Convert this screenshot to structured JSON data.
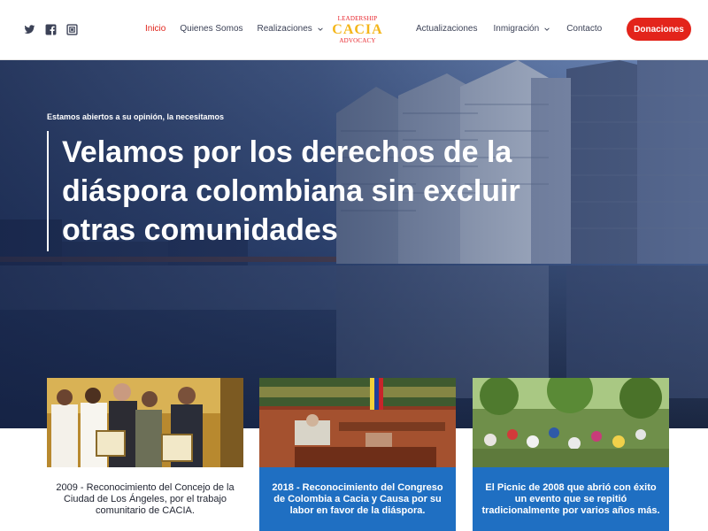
{
  "header": {
    "social": [
      {
        "icon": "twitter-icon"
      },
      {
        "icon": "facebook-icon"
      },
      {
        "icon": "instagram-icon"
      }
    ],
    "nav_left": [
      {
        "label": "Inicio",
        "active": true,
        "has_dropdown": false
      },
      {
        "label": "Quienes Somos",
        "active": false,
        "has_dropdown": false
      },
      {
        "label": "Realizaciones",
        "active": false,
        "has_dropdown": true
      }
    ],
    "logo": {
      "line1": "LEADERSHIP",
      "line2": "CACIA",
      "line3": "ADVOCACY"
    },
    "nav_right": [
      {
        "label": "Actualizaciones",
        "has_dropdown": false
      },
      {
        "label": "Inmigración",
        "has_dropdown": true
      },
      {
        "label": "Contacto",
        "has_dropdown": false
      }
    ],
    "donate_label": "Donaciones"
  },
  "hero": {
    "eyebrow": "Estamos abiertos a su opinión, la necesitamos",
    "headline": "Velamos por los derechos de la diáspora colombiana sin excluir otras comunidades"
  },
  "cards": [
    {
      "caption": "2009 - Reconocimiento del Concejo de la Ciudad de Los Ángeles, por el trabajo comunitario de CACIA."
    },
    {
      "caption": "2018 - Reconocimiento del Congreso de Colombia a Cacia y Causa por su labor en favor de la diáspora."
    },
    {
      "caption": "El Picnic de 2008 que abrió con éxito un evento que se repitió tradicionalmente por varios años más."
    }
  ],
  "colors": {
    "accent": "#e3241b",
    "nav_text": "#3c4257",
    "card_caption_blue": "#1f6fc2",
    "hero_overlay": "#142246"
  }
}
